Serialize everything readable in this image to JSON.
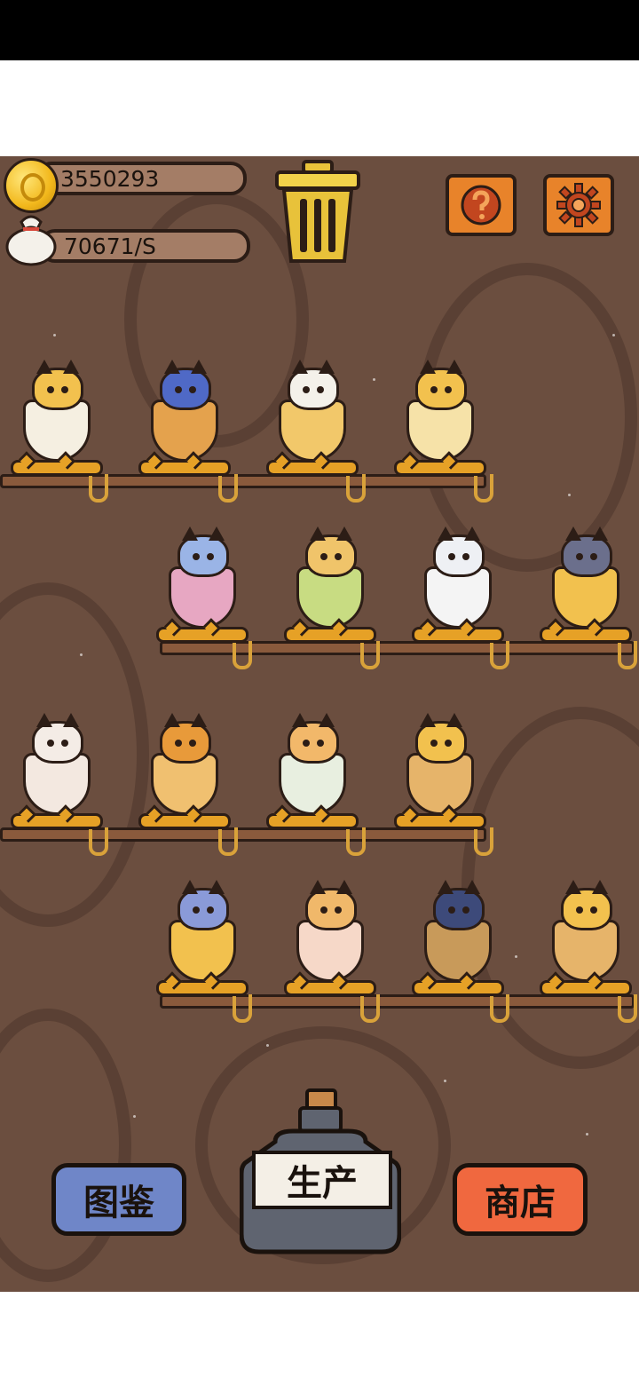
{
  "hud": {
    "coins": "3550293",
    "rate": "70671/S"
  },
  "buttons": {
    "codex": "图鉴",
    "produce": "生产",
    "shop": "商店"
  },
  "icons": {
    "coin": "coin-icon",
    "bag": "money-bag-icon",
    "trash": "trash-can-icon",
    "help": "question-mark-icon",
    "settings": "gear-icon"
  },
  "colors": {
    "wood": "#6b4e3f",
    "accent_orange": "#e8832a",
    "codex_blue": "#6f86c8",
    "shop_red": "#f0683f"
  },
  "shelves": [
    {
      "cats": [
        {
          "name": "cat-in-coffee-cup-with-crown",
          "fur": "#f2c14e",
          "cup": "#f5efe1"
        },
        {
          "name": "cat-in-tea-mug-with-apple-hat",
          "fur": "#4f69c6",
          "cup": "#e4a24d"
        },
        {
          "name": "cat-in-soup-bowl-red-jacket",
          "fur": "#f4f1ea",
          "cup": "#f2c86a"
        },
        {
          "name": "cat-in-goblet-with-sunglasses",
          "fur": "#f2c14e",
          "cup": "#f6e2a8"
        }
      ]
    },
    {
      "cats": [
        {
          "name": "cat-in-wine-glass-lion",
          "fur": "#9ab4e6",
          "cup": "#e7a7c2"
        },
        {
          "name": "cat-in-green-glass-sunflower",
          "fur": "#f0c46a",
          "cup": "#c8dc82"
        },
        {
          "name": "cat-in-bowl-blue-robe",
          "fur": "#eef0f4",
          "cup": "#f4f4f4"
        },
        {
          "name": "cats-in-beer-mug",
          "fur": "#6b6f8c",
          "cup": "#f2c14e"
        }
      ]
    },
    {
      "cats": [
        {
          "name": "cat-in-glass-with-spoon",
          "fur": "#f4ece6",
          "cup": "#f3e8e0"
        },
        {
          "name": "cat-in-glass-red-hat",
          "fur": "#e89a3a",
          "cup": "#f0c070"
        },
        {
          "name": "cat-in-teacup-blue-robe",
          "fur": "#f2b86a",
          "cup": "#e8efe0"
        },
        {
          "name": "cat-in-red-shirt-heart",
          "fur": "#f2c14e",
          "cup": "#e6b46a"
        }
      ]
    },
    {
      "cats": [
        {
          "name": "cat-in-beer-mug-wizard-hat",
          "fur": "#8a9ad8",
          "cup": "#f2c14e"
        },
        {
          "name": "cat-in-glass-llama",
          "fur": "#f0b86a",
          "cup": "#f6d8c8"
        },
        {
          "name": "cat-in-walnut-glass",
          "fur": "#3d4a7a",
          "cup": "#c89a5a"
        },
        {
          "name": "cat-in-red-shirt-heart-2",
          "fur": "#f2c14e",
          "cup": "#e6b46a"
        }
      ]
    }
  ]
}
